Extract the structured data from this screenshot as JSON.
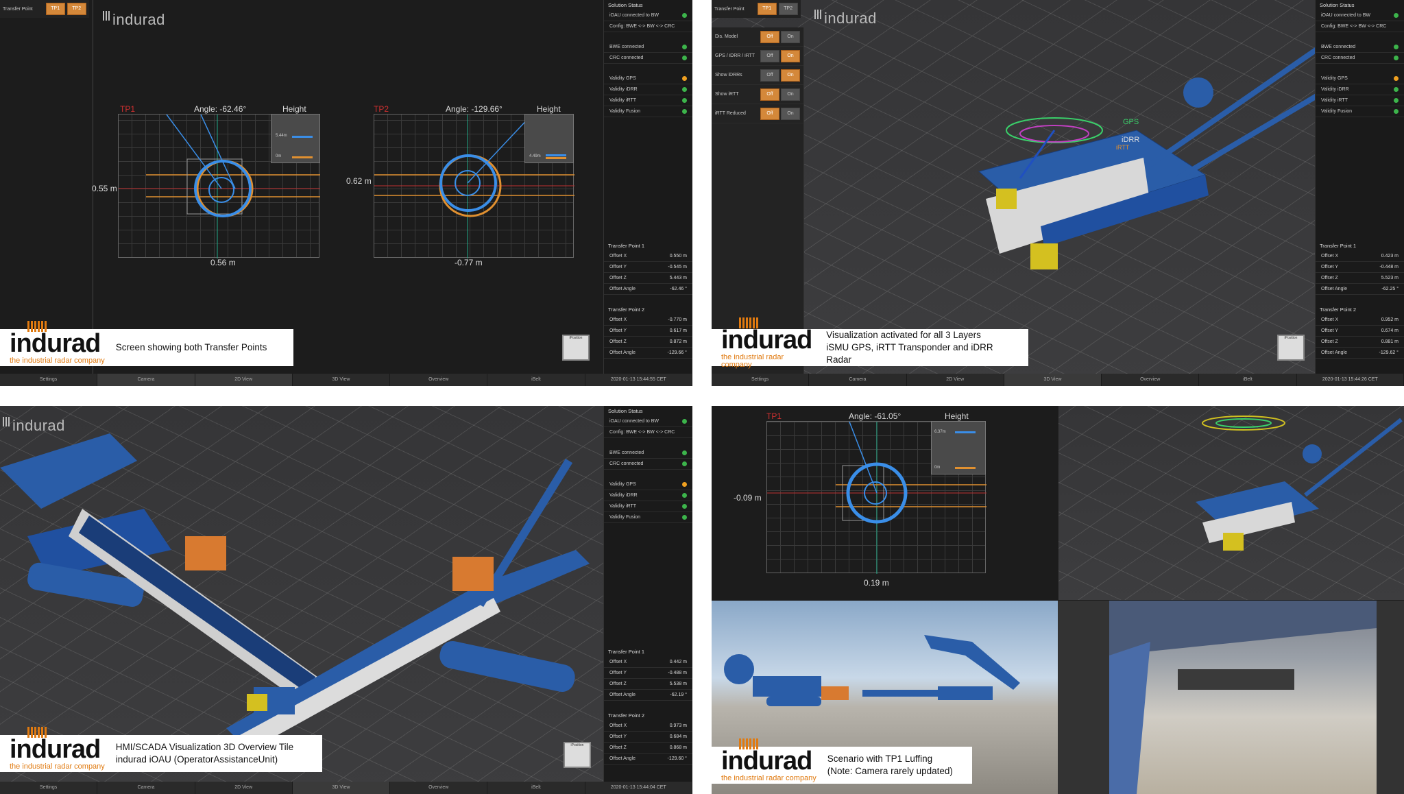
{
  "q1": {
    "top_bar": {
      "label": "Transfer Point",
      "tp1": "TP1",
      "tp2": "TP2"
    },
    "logo": "indurad",
    "tp1": {
      "label": "TP1",
      "angle": "Angle: -62.46°",
      "height": "Height",
      "h1": "5.44m",
      "h2": "0m",
      "left": "0.55 m",
      "bottom": "0.56 m"
    },
    "tp2": {
      "label": "TP2",
      "angle": "Angle: -129.66°",
      "height": "Height",
      "h1": "4.49m",
      "h2": "0m",
      "left": "0.62 m",
      "bottom": "-0.77 m"
    },
    "caption": "Screen showing both Transfer Points",
    "status": {
      "title": "Solution Status",
      "r1": "iOAU connected to BW",
      "r2": "Config: BWE <-> BW <-> CRC",
      "r3": "BWE connected",
      "r4": "CRC connected",
      "r5": "Validity GPS",
      "r6": "Validity iDRR",
      "r7": "Validity iRTT",
      "r8": "Validity Fusion"
    },
    "tp1_off": {
      "title": "Transfer Point 1",
      "x": "0.550 m",
      "y": "-0.545 m",
      "z": "5.443 m",
      "a": "-62.46 °"
    },
    "tp2_off": {
      "title": "Transfer Point 2",
      "x": "-0.770 m",
      "y": "0.617 m",
      "z": "0.872 m",
      "a": "-129.66 °"
    },
    "timestamp": "2020-01-13 15:44:55 CET"
  },
  "q2": {
    "caption1": "Visualization activated for all 3 Layers",
    "caption2": "iSMU GPS, iRTT Transponder and iDRR Radar",
    "ctrl": [
      {
        "label": "Dis. Model",
        "off": "Off",
        "on": "On"
      },
      {
        "label": "GPS / iDRR / iRTT",
        "off": "Off",
        "on": "On"
      },
      {
        "label": "Show iDRRs",
        "off": "Off",
        "on": "On"
      },
      {
        "label": "Show iRTT",
        "off": "Off",
        "on": "On"
      },
      {
        "label": "iRTT Reduced",
        "off": "Off",
        "on": "On"
      }
    ],
    "gps": "GPS",
    "idrr": "iDRR",
    "irtt": "iRTT",
    "tp1_off": {
      "x": "0.423 m",
      "y": "-0.448 m",
      "z": "5.523 m",
      "a": "-62.25 °"
    },
    "tp2_off": {
      "x": "0.952 m",
      "y": "0.674 m",
      "z": "0.881 m",
      "a": "-129.62 °"
    },
    "timestamp": "2020-01-13 15:44:26 CET"
  },
  "q3": {
    "caption1": "HMI/SCADA Visualization 3D Overview Tile",
    "caption2": "indurad iOAU (OperatorAssistanceUnit)",
    "tp1_off": {
      "x": "0.442 m",
      "y": "-0.488 m",
      "z": "5.538 m",
      "a": "-62.19 °"
    },
    "tp2_off": {
      "x": "0.973 m",
      "y": "0.684 m",
      "z": "0.868 m",
      "a": "-129.60 °"
    },
    "timestamp": "2020-01-13 15:44:04 CET"
  },
  "q4": {
    "tp1": {
      "label": "TP1",
      "angle": "Angle: -61.05°",
      "height": "Height",
      "h1": "6.37m",
      "h2": "0m",
      "left": "-0.09 m",
      "bottom": "0.19 m"
    },
    "caption1": "Scenario with TP1 Luffing",
    "caption2": "(Note: Camera rarely updated)"
  },
  "labels": {
    "x": "Offset X",
    "y": "Offset Y",
    "z": "Offset Z",
    "a": "Offset Angle",
    "tp1": "Transfer Point 1",
    "tp2": "Transfer Point 2"
  },
  "tabs": [
    "Settings",
    "Camera",
    "2D View",
    "3D View",
    "Overview",
    "iBelt"
  ],
  "brand": {
    "name": "indurad",
    "tag": "the industrial radar company"
  },
  "ipos": "iPosition"
}
